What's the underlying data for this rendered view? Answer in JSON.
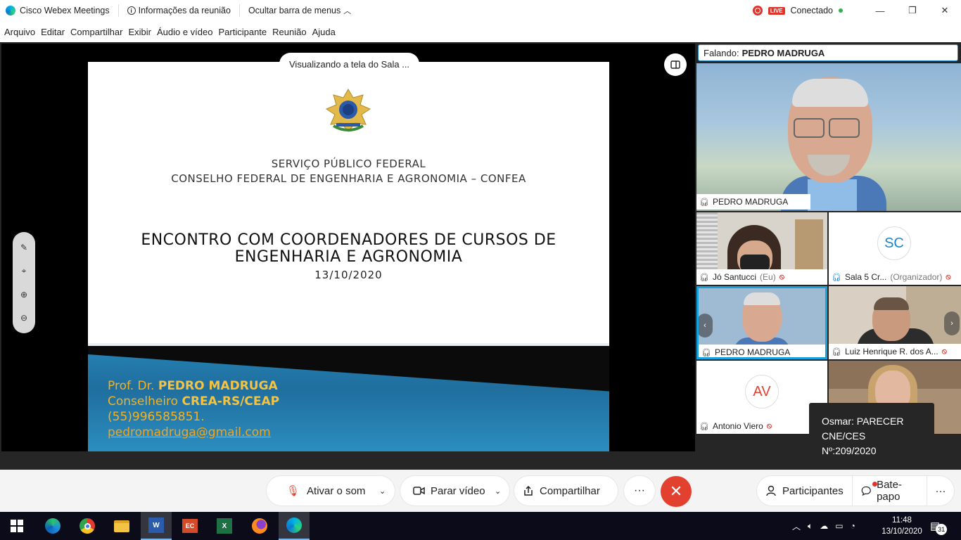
{
  "titlebar": {
    "app_name": "Cisco Webex Meetings",
    "meeting_info": "Informações da reunião",
    "hide_menu": "Ocultar barra de menus",
    "live": "LIVE",
    "status": "Conectado"
  },
  "menu": [
    "Arquivo",
    "Editar",
    "Compartilhar",
    "Exibir",
    "Áudio e vídeo",
    "Participante",
    "Reunião",
    "Ajuda"
  ],
  "share": {
    "viewing_label": "Visualizando a tela do Sala ..."
  },
  "slide": {
    "header_line1": "SERVIÇO PÚBLICO FEDERAL",
    "header_line2": "CONSELHO FEDERAL DE ENGENHARIA E AGRONOMIA – CONFEA",
    "title_line1": "ENCONTRO COM COORDENADORES  DE CURSOS DE",
    "title_line2": "ENGENHARIA E AGRONOMIA",
    "date": "13/10/2020",
    "author_prefix": "Prof. Dr. ",
    "author_name": "PEDRO MADRUGA",
    "role_prefix": "Conselheiro ",
    "role_name": "CREA-RS/CEAP",
    "phone": "(55)996585851.",
    "email": "pedromadruga@gmail.com"
  },
  "speaker": {
    "label": "Falando:",
    "name": "PEDRO MADRUGA"
  },
  "participants": {
    "main": "PEDRO MADRUGA",
    "jo": "Jó Santucci",
    "jo_tag": "(Eu)",
    "sala": "Sala 5 Cr...",
    "sala_tag": "(Organizador)",
    "sala_initials": "SC",
    "pedro_small": "PEDRO MADRUGA",
    "luiz": "Luiz Henrique R. dos A...",
    "antonio": "Antonio Viero",
    "antonio_initials": "AV"
  },
  "tooltip": {
    "line1": "Osmar: PARECER",
    "line2": "CNE/CES",
    "line3": "Nº:209/2020"
  },
  "controls": {
    "unmute": "Ativar o som",
    "stop_video": "Parar vídeo",
    "share": "Compartilhar",
    "participants": "Participantes",
    "chat": "Bate-papo"
  },
  "taskbar": {
    "time": "11:48",
    "date": "13/10/2020",
    "notif_count": "31"
  },
  "colors": {
    "accent": "#1b86c7",
    "end_call": "#e2412f",
    "slide_gold": "#f4b224"
  }
}
